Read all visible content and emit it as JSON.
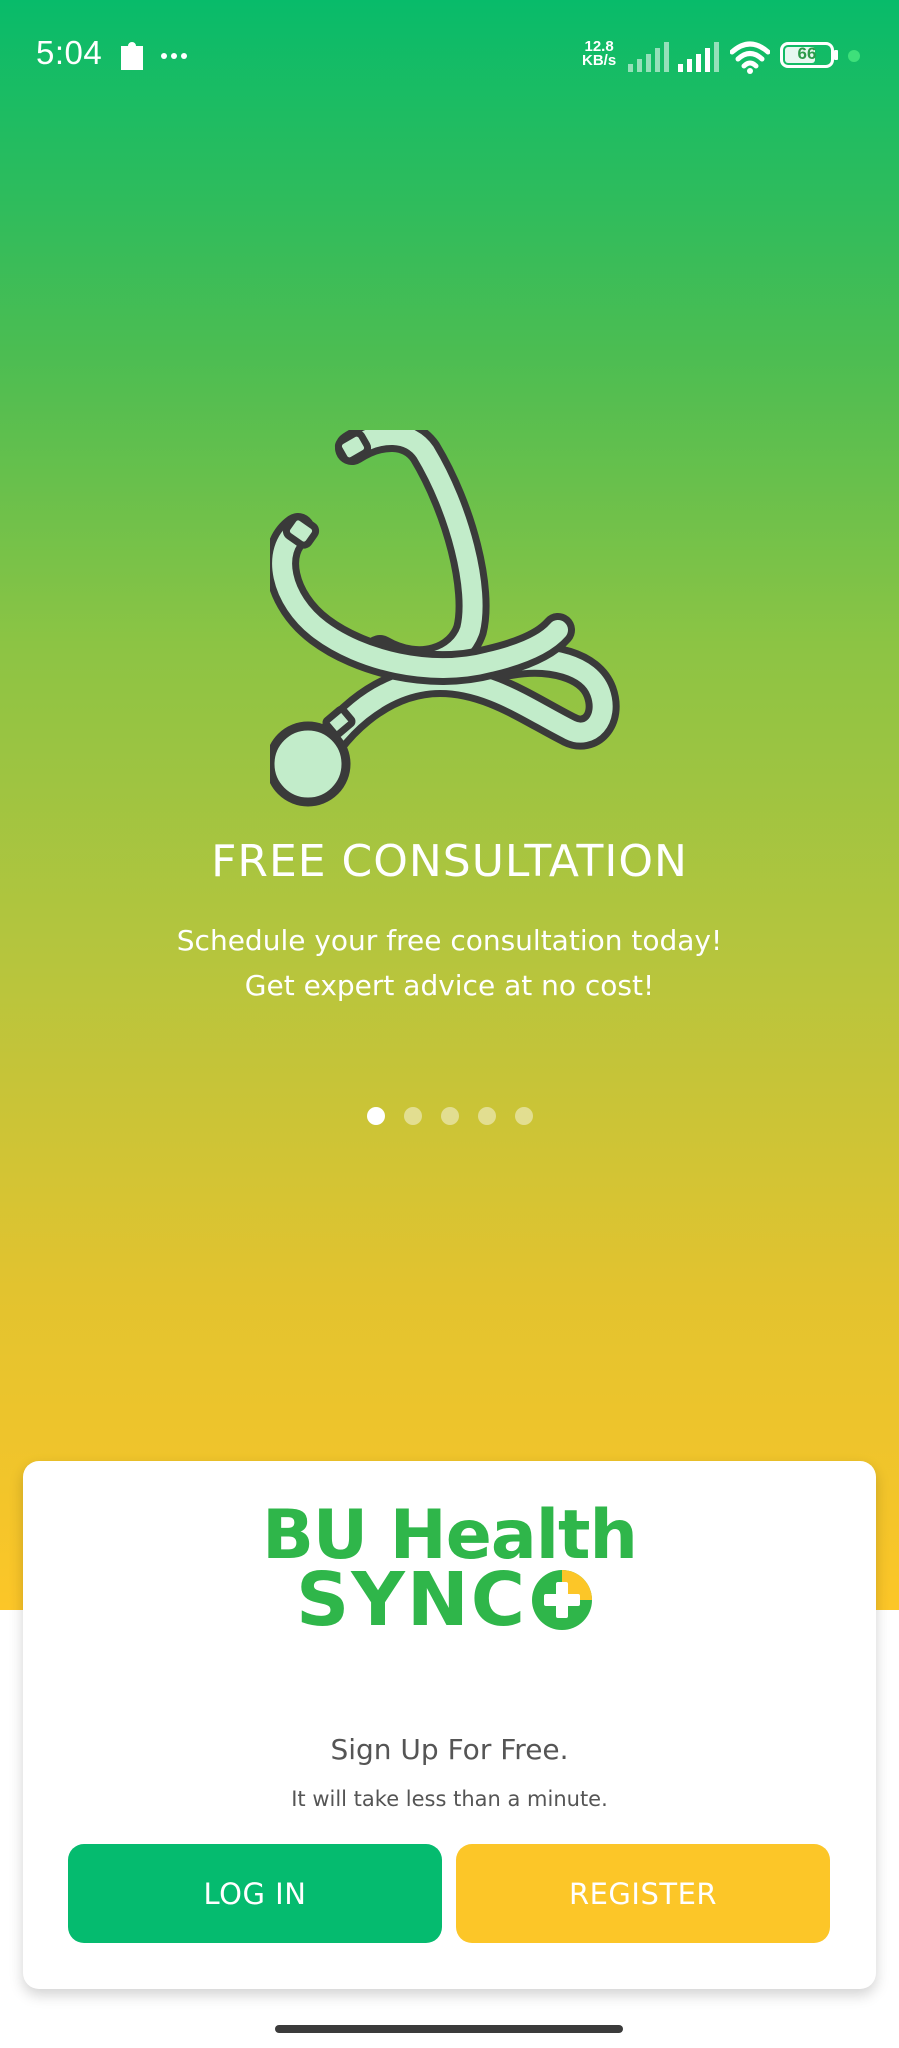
{
  "status_bar": {
    "time": "5:04",
    "net_speed_value": "12.8",
    "net_speed_unit": "KB/s",
    "battery": "66",
    "icons": [
      "puzzle-icon",
      "more-icon",
      "signal-icon",
      "signal-icon",
      "wifi-icon",
      "battery-icon"
    ]
  },
  "slide": {
    "title": "FREE CONSULTATION",
    "description_line1": "Schedule your free consultation today!",
    "description_line2": "Get expert advice at no cost!",
    "icon": "stethoscope-icon",
    "current_index": 0,
    "total": 5
  },
  "card": {
    "logo_line1": "BU Health",
    "logo_line2": "SYNC",
    "title": "Sign Up For Free.",
    "subtitle": "It will take less than a minute.",
    "login_label": "LOG IN",
    "register_label": "REGISTER"
  },
  "colors": {
    "green": "#05bb6f",
    "yellow": "#fcc628",
    "logo_green": "#2fb64a",
    "stethoscope_fill": "#c2ecca",
    "stethoscope_stroke": "#3a3a3a"
  }
}
